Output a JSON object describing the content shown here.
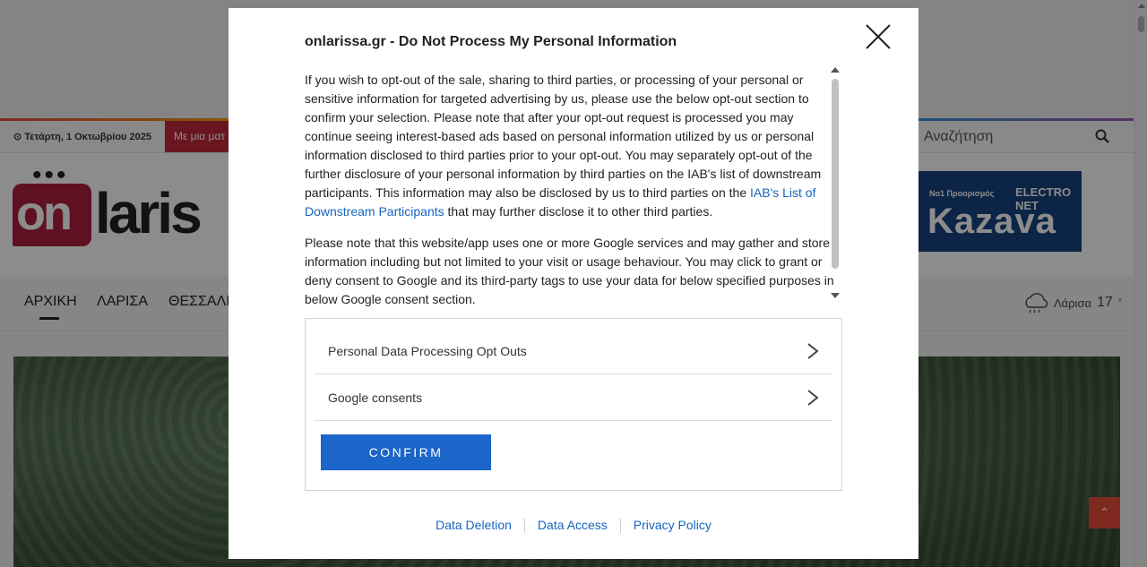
{
  "site": {
    "date": "⊙ Τετάρτη, 1 Οκτωβρίου 2025",
    "ticker": "Με μια ματ",
    "search_label": "Αναζήτηση",
    "logo": {
      "on": "on",
      "laris": "laris"
    },
    "banner": {
      "line1": "Νο1 Προορισμός",
      "line2": "ELECTRO NET",
      "line3": "Kazava"
    },
    "nav": [
      "ΑΡΧΙΚΗ",
      "ΛΑΡΙΣΑ",
      "ΘΕΣΣΑΛΙΑ"
    ],
    "weather": {
      "city": "Λάρισα",
      "temp": "17",
      "unit": "°"
    },
    "back_to_top": "⌃"
  },
  "modal": {
    "title": "onlarissa.gr - Do Not Process My Personal Information",
    "paragraph1_part1": "If you wish to opt-out of the sale, sharing to third parties, or processing of your personal or sensitive information for targeted advertising by us, please use the below opt-out section to confirm your selection. Please note that after your opt-out request is processed you may continue seeing interest-based ads based on personal information utilized by us or personal information disclosed to third parties prior to your opt-out. You may separately opt-out of the further disclosure of your personal information by third parties on the IAB's list of downstream participants. This information may also be disclosed by us to third parties on the ",
    "paragraph1_link": "IAB's List of Downstream Participants",
    "paragraph1_part2": " that may further disclose it to other third parties.",
    "paragraph2": "Please note that this website/app uses one or more Google services and may gather and store information including but not limited to your visit or usage behaviour. You may click to grant or deny consent to Google and its third-party tags to use your data for below specified purposes in below Google consent section.",
    "options": [
      {
        "label": "Personal Data Processing Opt Outs"
      },
      {
        "label": "Google consents"
      }
    ],
    "confirm_label": "CONFIRM",
    "footer_links": [
      "Data Deletion",
      "Data Access",
      "Privacy Policy"
    ]
  }
}
